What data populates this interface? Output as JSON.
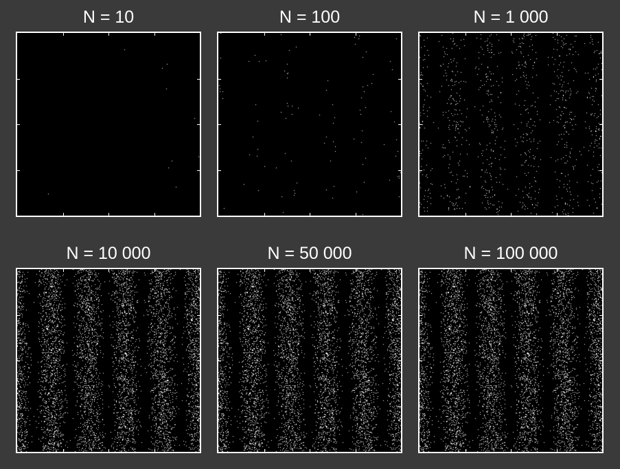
{
  "colors": {
    "background": "#3a3a3a",
    "points": "#ffffff",
    "plot_bg": "#000000",
    "frame": "#ffffff"
  },
  "chart_data": [
    {
      "type": "scatter",
      "title": "N = 10",
      "n": 10,
      "fringes": 5,
      "grid": false,
      "axes_tick_labels": false
    },
    {
      "type": "scatter",
      "title": "N = 100",
      "n": 100,
      "fringes": 5,
      "grid": false,
      "axes_tick_labels": false
    },
    {
      "type": "scatter",
      "title": "N = 1 000",
      "n": 1000,
      "fringes": 5,
      "grid": false,
      "axes_tick_labels": false
    },
    {
      "type": "scatter",
      "title": "N = 10 000",
      "n": 10000,
      "fringes": 5,
      "grid": false,
      "axes_tick_labels": false
    },
    {
      "type": "scatter",
      "title": "N = 50 000",
      "n": 50000,
      "fringes": 5,
      "grid": false,
      "axes_tick_labels": false
    },
    {
      "type": "scatter",
      "title": "N = 100 000",
      "n": 100000,
      "fringes": 5,
      "grid": false,
      "axes_tick_labels": false
    }
  ]
}
